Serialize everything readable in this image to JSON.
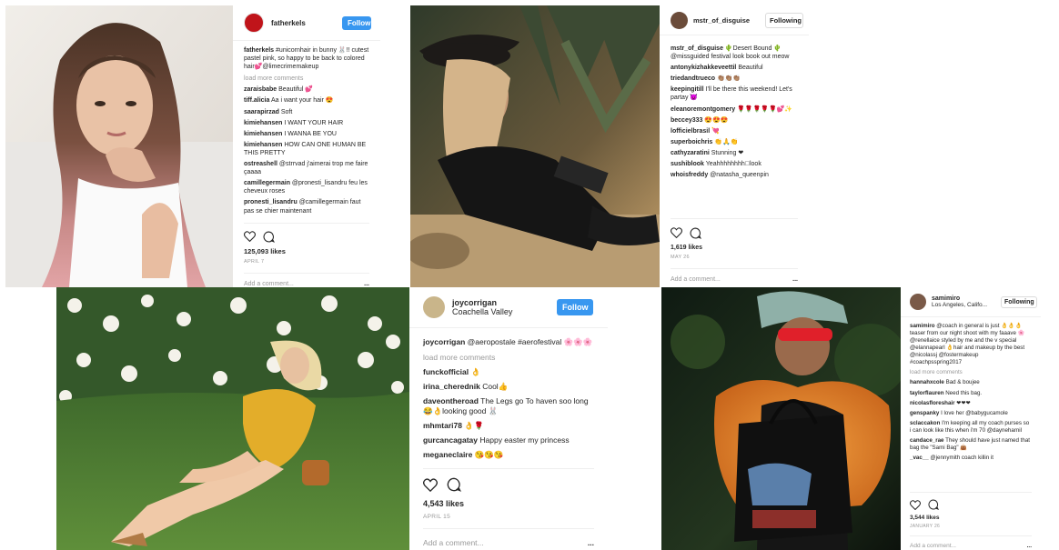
{
  "posts": [
    {
      "username": "fatherkels",
      "follow_label": "Follow",
      "caption_user": "fatherkels",
      "caption_text": "#unicornhair in bunny 🐰!! cutest pastel pink, so happy to be back to colored hair💕@limecrimemakeup",
      "load_more": "load more comments",
      "comments": [
        {
          "user": "zaraisbabe",
          "text": "Beautiful 💕"
        },
        {
          "user": "tiff.alicia",
          "text": "Aa i want your hair 😍"
        },
        {
          "user": "saarapirzad",
          "text": "Soft"
        },
        {
          "user": "kimiehansen",
          "text": "I WANT YOUR HAIR"
        },
        {
          "user": "kimiehansen",
          "text": "I WANNA BE YOU"
        },
        {
          "user": "kimiehansen",
          "text": "HOW CAN ONE HUMAN BE THIS PRETTY"
        },
        {
          "user": "ostreashell",
          "text": "@strrvad j'aimerai trop me faire çaaaa"
        },
        {
          "user": "camillegermain",
          "text": "@pronesti_lisandru feu les cheveux roses"
        },
        {
          "user": "pronesti_lisandru",
          "text": "@camillegermain faut pas se chier maintenant"
        }
      ],
      "likes": "125,093 likes",
      "date": "APRIL 7",
      "add_comment": "Add a comment...",
      "more": "..."
    },
    {
      "username": "mstr_of_disguise",
      "follow_label": "Following",
      "caption_user": "mstr_of_disguise",
      "caption_text": "🌵Desert Bound 🌵 @missguided festival look book out meow",
      "comments": [
        {
          "user": "antonykizhakkeveettil",
          "text": "Beautiful"
        },
        {
          "user": "triedandtrueco",
          "text": "👏🏽👏🏽👏🏽"
        },
        {
          "user": "keepingitill",
          "text": "I'll be there this weekend! Let's partay 😈"
        },
        {
          "user": "eleanoremontgomery",
          "text": "🌹🌹🌹🌹🌹💕✨"
        },
        {
          "user": "beccey333",
          "text": "😍😍😍"
        },
        {
          "user": "lofficielbrasil",
          "text": "💘"
        },
        {
          "user": "superboichris",
          "text": "👏🙏👏"
        },
        {
          "user": "cathyzaratini",
          "text": "Stunning ❤"
        },
        {
          "user": "sushiblook",
          "text": "Yeahhhhhhhh🏽look"
        },
        {
          "user": "whoisfreddy",
          "text": "@natasha_queenpin"
        }
      ],
      "likes": "1,619 likes",
      "date": "MAY 26",
      "add_comment": "Add a comment...",
      "more": "..."
    },
    {
      "username": "joycorrigan",
      "location": "Coachella Valley",
      "follow_label": "Follow",
      "caption_user": "joycorrigan",
      "caption_text": "@aeropostale #aerofestival 🌸🌸🌸",
      "load_more": "load more comments",
      "comments": [
        {
          "user": "funckofficial",
          "text": "👌"
        },
        {
          "user": "irina_cherednik",
          "text": "Cool👍"
        },
        {
          "user": "daveontheroad",
          "text": "The Legs go To haven soo long 😂👌looking good 🐰"
        },
        {
          "user": "mhmtari78",
          "text": "👌🌹"
        },
        {
          "user": "gurcancagatay",
          "text": "Happy easter my princess"
        },
        {
          "user": "meganeclaire",
          "text": "😘😘😘"
        }
      ],
      "likes": "4,543 likes",
      "date": "APRIL 15",
      "add_comment": "Add a comment...",
      "more": "..."
    },
    {
      "username": "samimiro",
      "location": "Los Angeles, Califo...",
      "follow_label": "Following",
      "caption_user": "samimiro",
      "caption_text": "@coach in general is just 👌👌👌 teaser from our night shoot with my faaave 🌸@renellaice styled by me and the v special @elannapearl 👌hair and makeup by the best @nicolassj @fostermakeup #coachpsspring2017",
      "load_more": "load more comments",
      "comments": [
        {
          "user": "hannahxcole",
          "text": "Bad & boujee"
        },
        {
          "user": "taylorflauren",
          "text": "Need this bag."
        },
        {
          "user": "nicolasfloreshair",
          "text": "❤❤❤"
        },
        {
          "user": "genspanky",
          "text": "I love her @babygucamole"
        },
        {
          "user": "sclaccakon",
          "text": "I'm keeping all my coach purses so i can look like this when i'm 70 @dayneharnil"
        },
        {
          "user": "candace_rae",
          "text": "They should have just named that bag the \"Sami Bag\" 👜"
        },
        {
          "user": "_vac__",
          "text": "@jennymith coach killin it"
        }
      ],
      "likes": "3,544 likes",
      "date": "JANUARY 26",
      "add_comment": "Add a comment...",
      "more": "..."
    }
  ],
  "colors": {
    "follow_blue": "#3897f0",
    "muted": "#999999",
    "border": "#efefef"
  },
  "icons": [
    "heart-icon",
    "comment-icon",
    "more-options-icon"
  ]
}
